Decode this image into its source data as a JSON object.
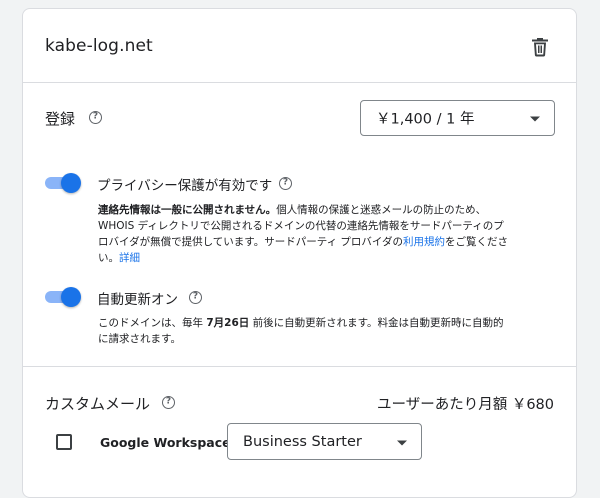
{
  "domain": {
    "name": "kabe-log.net"
  },
  "registration": {
    "label": "登録",
    "selected": "￥1,400 / 1 年"
  },
  "privacy": {
    "label": "プライバシー保護が有効です",
    "desc_bold": "連絡先情報は一般に公開されません。",
    "desc_text": "個人情報の保護と迷惑メールの防止のため、WHOIS ディレクトリで公開されるドメインの代替の連絡先情報をサードパーティのプロバイダが無償で提供しています。サードパーティ プロバイダの",
    "terms_link": "利用規約",
    "desc_after": "をご覧ください。",
    "details_link": "詳細"
  },
  "auto_renew": {
    "label": "自動更新オン",
    "desc_before": "このドメインは、毎年 ",
    "date": "7月26日",
    "desc_after": " 前後に自動更新されます。料金は自動更新時に自動的に請求されます。"
  },
  "custom_email": {
    "label": "カスタムメール",
    "price": "ユーザーあたり月額 ￥680",
    "workspace_label": "Google Workspace",
    "plan_selected": "Business Starter"
  },
  "colors": {
    "accent": "#1a73e8",
    "toggle_track": "#8ab4f8",
    "border": "#dadce0"
  }
}
